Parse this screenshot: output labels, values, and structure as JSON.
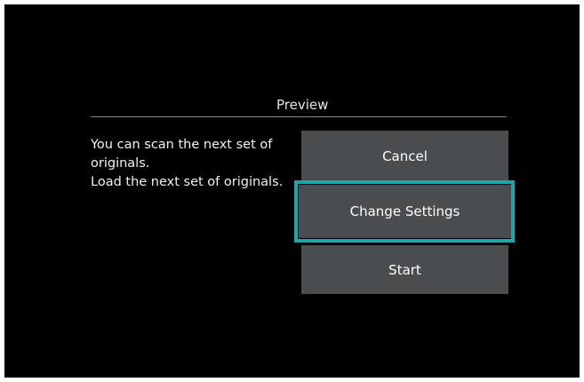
{
  "dialog": {
    "title": "Preview",
    "message_line1": "You can scan the next set of originals.",
    "message_line2": "Load the next set of originals."
  },
  "buttons": {
    "cancel": "Cancel",
    "change_settings": "Change Settings",
    "start": "Start"
  },
  "colors": {
    "background": "#000000",
    "button": "#4a4d50",
    "focus": "#1fa6aa",
    "text": "#ffffff"
  },
  "focused_button": "change_settings"
}
